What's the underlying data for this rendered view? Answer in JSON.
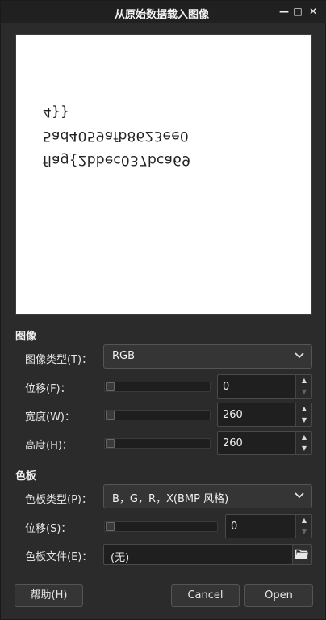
{
  "window": {
    "title": "从原始数据载入图像",
    "minimize_glyph": "—",
    "maximize_glyph": "□",
    "close_glyph": "✕"
  },
  "preview": {
    "lines": [
      "4}}",
      "5ad4059afb8623ee0",
      "flag{2bbec037bca69"
    ]
  },
  "image_section": {
    "heading": "图像",
    "type_label": "图像类型(T)：",
    "type_value": "RGB",
    "offset_label": "位移(F)：",
    "offset_value": "0",
    "width_label": "宽度(W)：",
    "width_value": "260",
    "height_label": "高度(H)：",
    "height_value": "260"
  },
  "palette_section": {
    "heading": "色板",
    "type_label": "色板类型(P)：",
    "type_value": "B，G，R，X(BMP 风格)",
    "offset_label": "位移(S)：",
    "offset_value": "0",
    "file_label": "色板文件(E)：",
    "file_value": "(无)"
  },
  "buttons": {
    "help": "帮助(H)",
    "cancel": "Cancel",
    "open": "Open"
  },
  "icons": {
    "chevron": "chevron-down-icon",
    "folder": "folder-open-icon",
    "spin_up": "arrow-up-icon",
    "spin_down": "arrow-down-icon"
  }
}
